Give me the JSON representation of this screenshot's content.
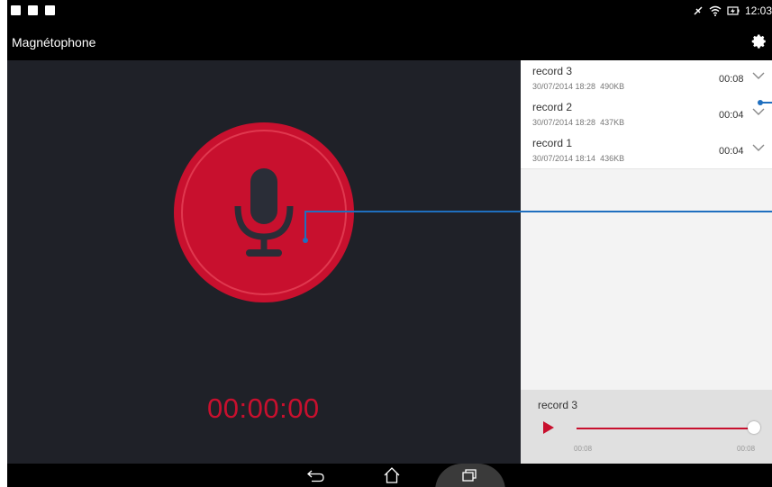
{
  "status_bar": {
    "left_icons": [
      "document-icon",
      "image-icon",
      "clipboard-icon"
    ],
    "right_icons": [
      "mute-icon",
      "wifi-icon",
      "battery-charging-icon"
    ],
    "time": "12:03"
  },
  "action_bar": {
    "title": "Magnétophone",
    "settings_icon": "gear-icon"
  },
  "recorder": {
    "timer": "00:00:00",
    "record_icon": "microphone-icon",
    "accent_color": "#c8102e"
  },
  "recordings": [
    {
      "name": "record 3",
      "date": "30/07/2014 18:28",
      "size": "490KB",
      "duration": "00:08"
    },
    {
      "name": "record 2",
      "date": "30/07/2014 18:28",
      "size": "437KB",
      "duration": "00:04"
    },
    {
      "name": "record 1",
      "date": "30/07/2014 18:14",
      "size": "436KB",
      "duration": "00:04"
    }
  ],
  "player": {
    "current": "record 3",
    "elapsed": "00:08",
    "total": "00:08",
    "progress": 1.0
  },
  "nav_bar": {
    "icons": [
      "back-icon",
      "home-icon",
      "recent-apps-icon"
    ]
  }
}
